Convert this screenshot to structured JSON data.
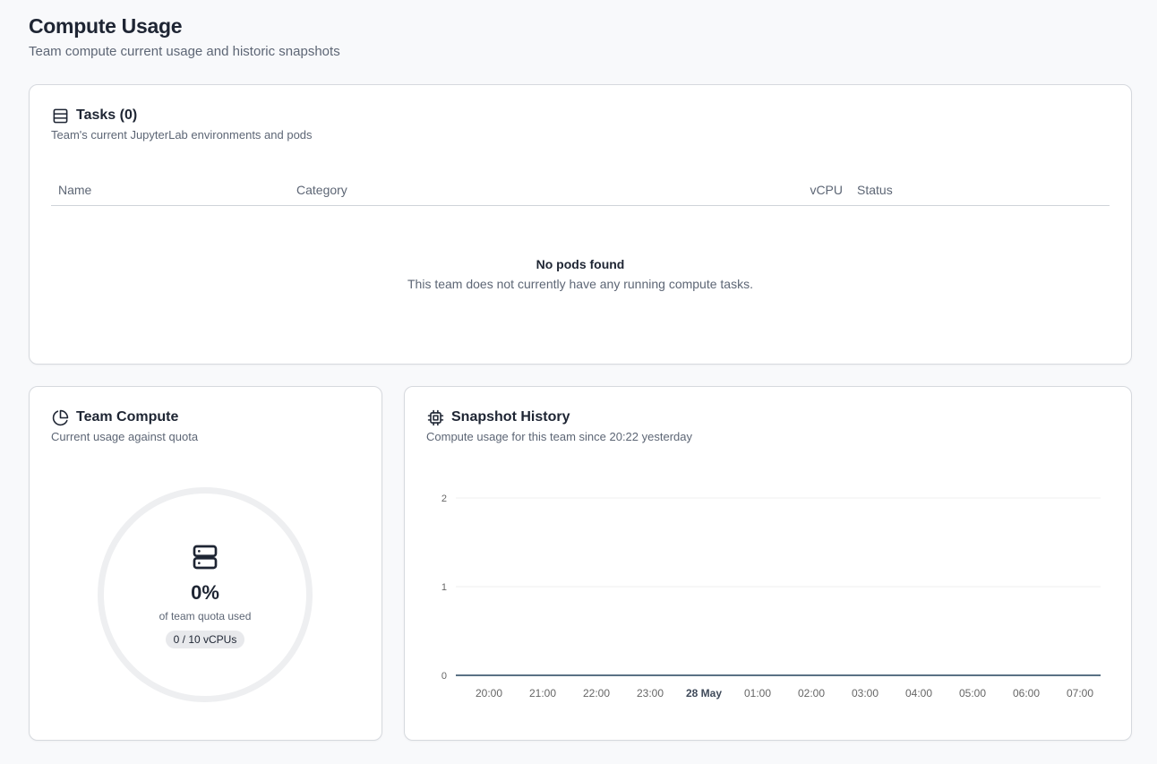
{
  "page": {
    "title": "Compute Usage",
    "subtitle": "Team compute current usage and historic snapshots"
  },
  "tasks": {
    "title": "Tasks (0)",
    "description": "Team's current JupyterLab environments and pods",
    "icon": "table-icon",
    "columns": [
      "Name",
      "Category",
      "vCPU",
      "Status"
    ],
    "rows": [],
    "empty_title": "No pods found",
    "empty_description": "This team does not currently have any running compute tasks."
  },
  "team_compute": {
    "title": "Team Compute",
    "description": "Current usage against quota",
    "icon": "pie-chart-icon",
    "center_icon": "server-icon",
    "percent": "0%",
    "percent_value": 0,
    "caption": "of team quota used",
    "badge": "0 / 10 vCPUs"
  },
  "snapshot_history": {
    "title": "Snapshot History",
    "description": "Compute usage for this team since 20:22 yesterday",
    "icon": "cpu-icon"
  },
  "chart_data": {
    "type": "line",
    "x": [
      "20:00",
      "21:00",
      "22:00",
      "23:00",
      "28 May",
      "01:00",
      "02:00",
      "03:00",
      "04:00",
      "05:00",
      "06:00",
      "07:00"
    ],
    "x_bold": [
      "28 May"
    ],
    "series": [
      {
        "values": [
          0,
          0,
          0,
          0,
          0,
          0,
          0,
          0,
          0,
          0,
          0,
          0
        ]
      }
    ],
    "y_ticks": [
      0,
      1,
      2
    ],
    "ylim": [
      0,
      2
    ],
    "grid": true,
    "title": "",
    "xlabel": "",
    "ylabel": "",
    "colors": {
      "line": "#5a7185",
      "grid": "#efefef",
      "axis": "#666666"
    }
  }
}
